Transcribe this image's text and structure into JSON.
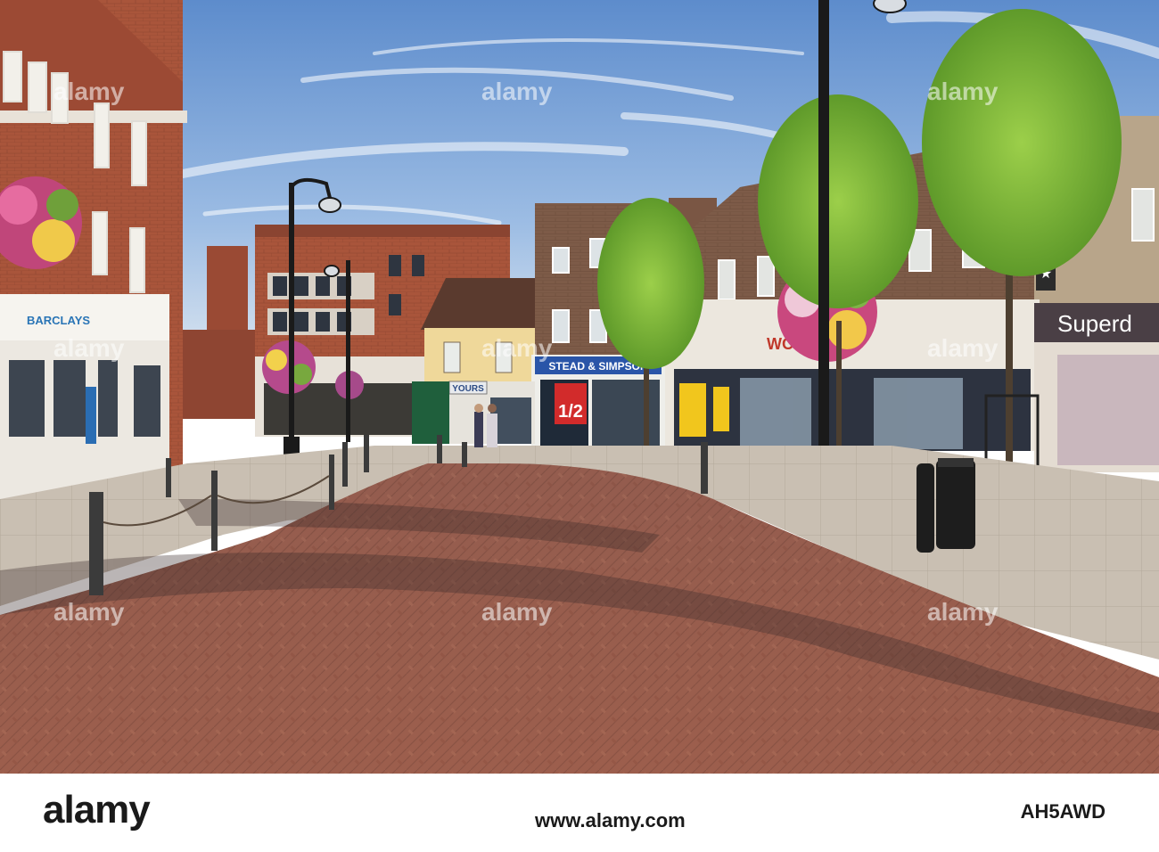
{
  "signs": {
    "bank": "BARCLAYS",
    "shop_yours": "YOURS",
    "shop_stead": "STEAD & SIMPSON",
    "shop_half": "1/2",
    "shop_wool": "WO",
    "shop_super": "Superd"
  },
  "watermark": {
    "label": "alamy"
  },
  "footer": {
    "logo": "alamy",
    "url": "www.alamy.com",
    "image_ref": "AH5AWD"
  },
  "colors": {
    "sky": "#7ea6d8",
    "brick": "#a4553c",
    "paving": "#9c6150",
    "pavement": "#c6bcb0"
  }
}
